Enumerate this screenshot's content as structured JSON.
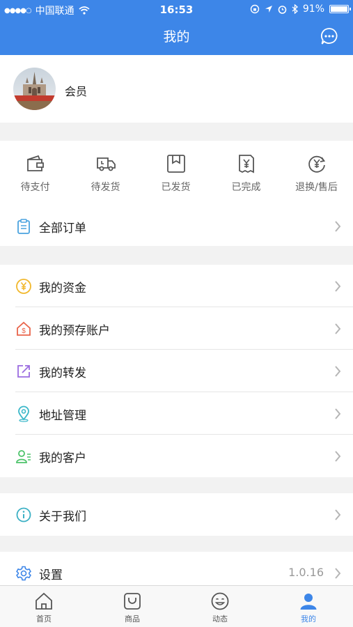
{
  "status_bar": {
    "signal": "●●●●○",
    "carrier": "中国联通",
    "time": "16:53",
    "battery": "91%",
    "battery_level": 0.91
  },
  "header": {
    "title": "我的"
  },
  "profile": {
    "name": "会员"
  },
  "orders": {
    "statuses": [
      {
        "label": "待支付",
        "icon": "wallet-icon"
      },
      {
        "label": "待发货",
        "icon": "truck-icon"
      },
      {
        "label": "已发货",
        "icon": "package-icon"
      },
      {
        "label": "已完成",
        "icon": "receipt-icon"
      },
      {
        "label": "退换/售后",
        "icon": "refund-icon"
      }
    ],
    "all_orders": "全部订单"
  },
  "menu": {
    "funds": "我的资金",
    "prepaid": "我的预存账户",
    "shares": "我的转发",
    "address": "地址管理",
    "customers": "我的客户",
    "about": "关于我们",
    "settings": "设置",
    "version": "1.0.16"
  },
  "tabbar": [
    {
      "label": "首页",
      "icon": "home-icon"
    },
    {
      "label": "商品",
      "icon": "shopping-bag-icon"
    },
    {
      "label": "动态",
      "icon": "smiley-icon"
    },
    {
      "label": "我的",
      "icon": "user-icon"
    }
  ],
  "colors": {
    "accent": "#3d86e8",
    "background": "#f2f2f2"
  }
}
